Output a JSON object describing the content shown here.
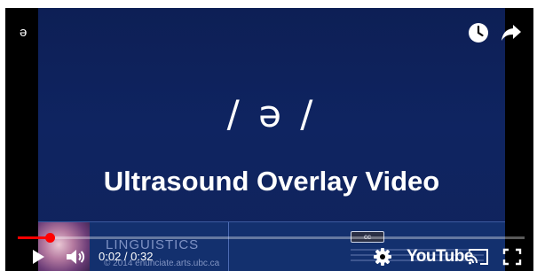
{
  "player": {
    "title_char": "ə",
    "time_current": "0:02",
    "time_separator": " / ",
    "time_total": "0:32",
    "progress_fraction": 0.0625,
    "brand_label": "YouTube",
    "accent_color": "#ff0000"
  },
  "video": {
    "phoneme": "/ ə /",
    "subtitle": "Ultrasound Overlay Video",
    "footer_brand": "LINGUISTICS",
    "footer_copyright": "© 2014 enunciate.arts.ubc.ca",
    "license_badge": "cc"
  },
  "icons": {
    "watch_later": "clock-icon",
    "share": "share-arrow-icon",
    "play": "play-icon",
    "volume": "volume-icon",
    "settings": "gear-icon",
    "cast": "cast-icon",
    "fullscreen": "fullscreen-icon"
  }
}
